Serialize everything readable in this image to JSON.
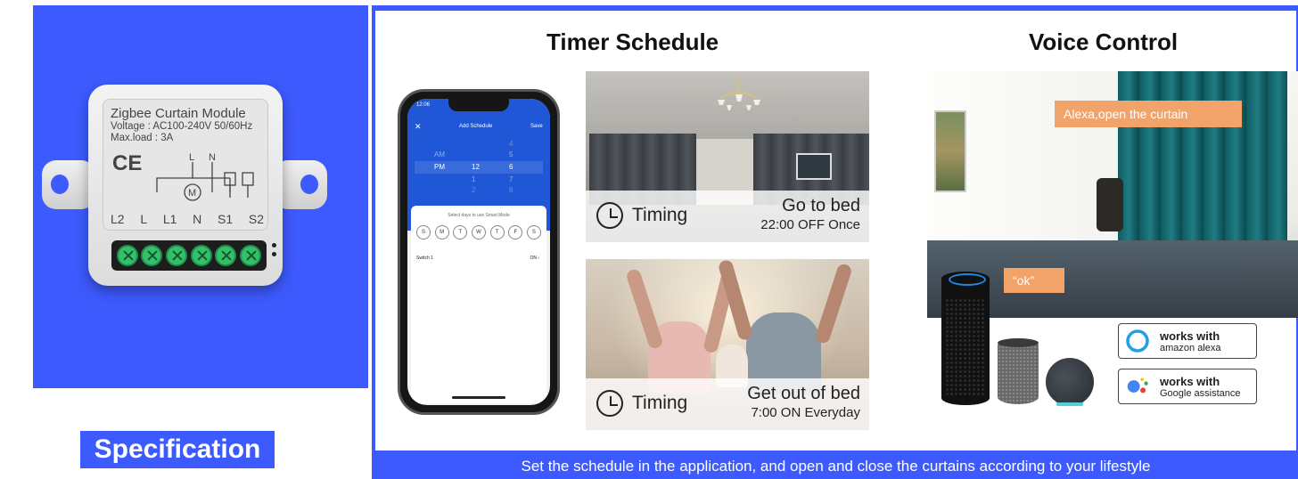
{
  "module": {
    "title": "Zigbee Curtain Module",
    "voltage": "Voltage : AC100-240V 50/60Hz",
    "maxload": "Max.load : 3A",
    "ce": "CE",
    "terminals": [
      "L2",
      "L",
      "L1",
      "N",
      "S1",
      "S2"
    ],
    "circuit_top": [
      "L",
      "N"
    ],
    "circuit_motor": "M"
  },
  "spec_title": "Specification",
  "timer": {
    "heading": "Timer Schedule",
    "phone": {
      "time": "12:06",
      "header_title": "Add Schedule",
      "save": "Save",
      "picker": {
        "rows": [
          {
            "ampm": "",
            "hour": "",
            "min": "4"
          },
          {
            "ampm": "AM",
            "hour": "",
            "min": "5"
          },
          {
            "ampm": "PM",
            "hour": "12",
            "min": "6"
          },
          {
            "ampm": "",
            "hour": "1",
            "min": "7"
          },
          {
            "ampm": "",
            "hour": "2",
            "min": "8"
          }
        ]
      },
      "days_label": "Select days to use Smart Mode",
      "days": [
        "S",
        "M",
        "T",
        "W",
        "T",
        "F",
        "S"
      ],
      "switch_label": "Switch 1",
      "switch_value": "ON ›"
    },
    "events": [
      {
        "timing": "Timing",
        "title": "Go to bed",
        "detail": "22:00 OFF Once"
      },
      {
        "timing": "Timing",
        "title": "Get out of bed",
        "detail": "7:00 ON Everyday"
      }
    ]
  },
  "voice": {
    "heading": "Voice Control",
    "bubble1": "Alexa,open the curtain",
    "bubble2": "“ok”",
    "badges": [
      {
        "line1": "works with",
        "line2": "amazon alexa",
        "icon": "alexa-ring-icon"
      },
      {
        "line1": "works with",
        "line2": "Google assistance",
        "icon": "google-assistant-icon"
      }
    ]
  },
  "caption": "Set the schedule in the application, and open and close the curtains according to your lifestyle",
  "colors": {
    "brand_blue": "#3d5afe",
    "terminal_green": "#34c06b",
    "bubble_orange": "#f2a36a",
    "curtain_teal": "#1f7c82"
  }
}
